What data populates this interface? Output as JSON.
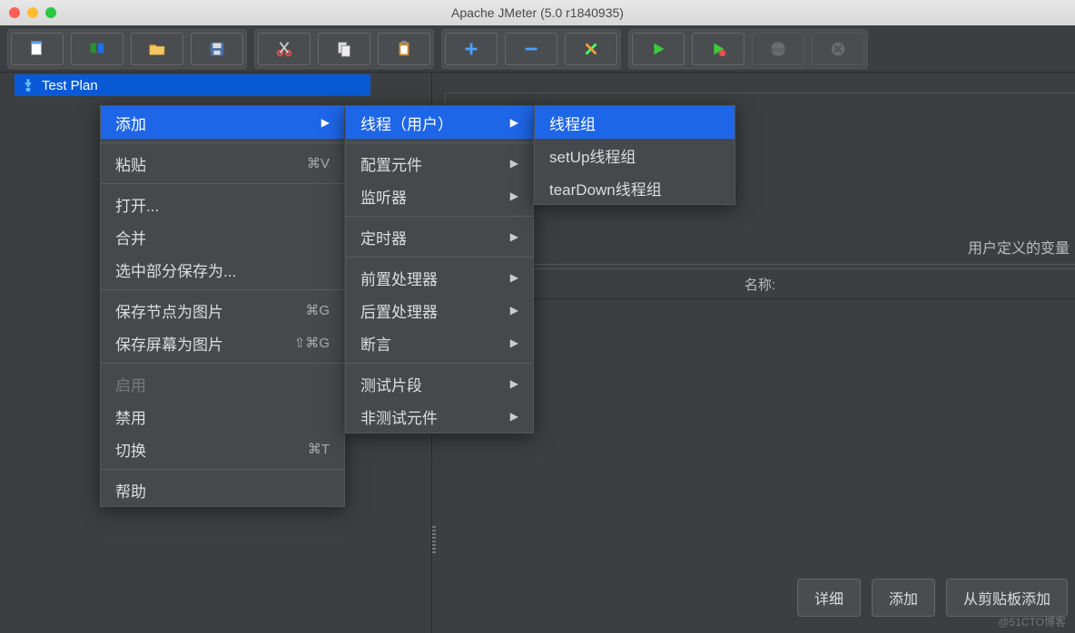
{
  "window": {
    "title": "Apache JMeter (5.0 r1840935)"
  },
  "toolbar": {
    "icons": [
      "new",
      "templates",
      "open",
      "save",
      "cut",
      "copy",
      "paste",
      "add",
      "remove",
      "edit",
      "run",
      "run-debug",
      "stop",
      "close"
    ]
  },
  "tree": {
    "root_label": "Test Plan"
  },
  "context_menu": {
    "items": [
      {
        "label": "添加",
        "highlight": true,
        "submenu": true
      },
      {
        "sep": true
      },
      {
        "label": "粘贴",
        "shortcut": "⌘V"
      },
      {
        "sep": true
      },
      {
        "label": "打开..."
      },
      {
        "label": "合并"
      },
      {
        "label": "选中部分保存为..."
      },
      {
        "sep": true
      },
      {
        "label": "保存节点为图片",
        "shortcut": "⌘G"
      },
      {
        "label": "保存屏幕为图片",
        "shortcut": "⇧⌘G"
      },
      {
        "sep": true
      },
      {
        "label": "启用",
        "disabled": true
      },
      {
        "label": "禁用"
      },
      {
        "label": "切换",
        "shortcut": "⌘T"
      },
      {
        "sep": true
      },
      {
        "label": "帮助"
      }
    ]
  },
  "submenu_add": {
    "items": [
      {
        "label": "线程（用户）",
        "highlight": true,
        "submenu": true
      },
      {
        "sep": true
      },
      {
        "label": "配置元件",
        "submenu": true
      },
      {
        "label": "监听器",
        "submenu": true
      },
      {
        "sep": true
      },
      {
        "label": "定时器",
        "submenu": true
      },
      {
        "sep": true
      },
      {
        "label": "前置处理器",
        "submenu": true
      },
      {
        "label": "后置处理器",
        "submenu": true
      },
      {
        "label": "断言",
        "submenu": true
      },
      {
        "sep": true
      },
      {
        "label": "测试片段",
        "submenu": true
      },
      {
        "label": "非测试元件",
        "submenu": true
      }
    ]
  },
  "submenu_threads": {
    "items": [
      {
        "label": "线程组",
        "highlight": true
      },
      {
        "label": "setUp线程组"
      },
      {
        "label": "tearDown线程组"
      }
    ]
  },
  "right_panel": {
    "section_title": "用户定义的变量",
    "column_header": "名称:"
  },
  "bottom_buttons": {
    "detail": "详细",
    "add": "添加",
    "from_clipboard": "从剪贴板添加"
  },
  "watermark": "@51CTO博客"
}
